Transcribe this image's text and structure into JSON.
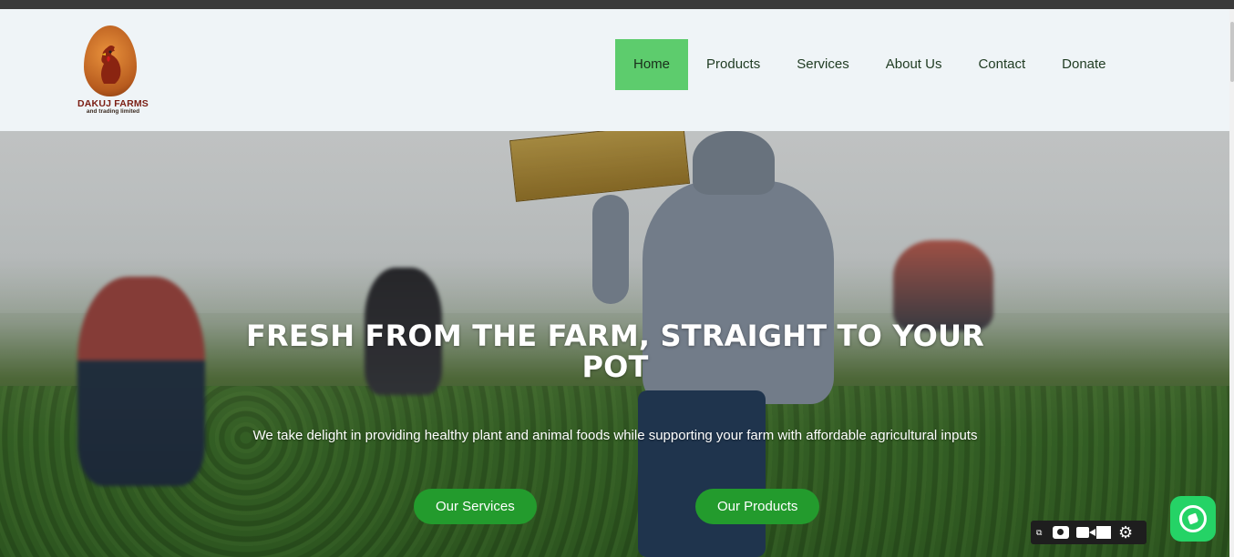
{
  "header": {
    "logo": {
      "brand": "DAKUJ FARMS",
      "tagline": "and trading limited"
    },
    "nav": [
      {
        "label": "Home",
        "active": true
      },
      {
        "label": "Products",
        "active": false
      },
      {
        "label": "Services",
        "active": false
      },
      {
        "label": "About Us",
        "active": false
      },
      {
        "label": "Contact",
        "active": false
      },
      {
        "label": "Donate",
        "active": false
      }
    ]
  },
  "hero": {
    "title": "FRESH FROM THE FARM, STRAIGHT TO YOUR POT",
    "text": "We take delight in providing healthy plant and animal foods while supporting your farm with affordable agricultural inputs",
    "buttons": {
      "services": "Our Services",
      "products": "Our Products"
    }
  },
  "toolbar": {
    "icons": [
      "screenshot-icon",
      "camera-icon",
      "video-icon",
      "window-icon",
      "gear-icon"
    ]
  },
  "colors": {
    "nav_active": "#5dcc6d",
    "button_green": "#239b2d",
    "whatsapp": "#25d366",
    "header_bg": "#eff4f7"
  }
}
